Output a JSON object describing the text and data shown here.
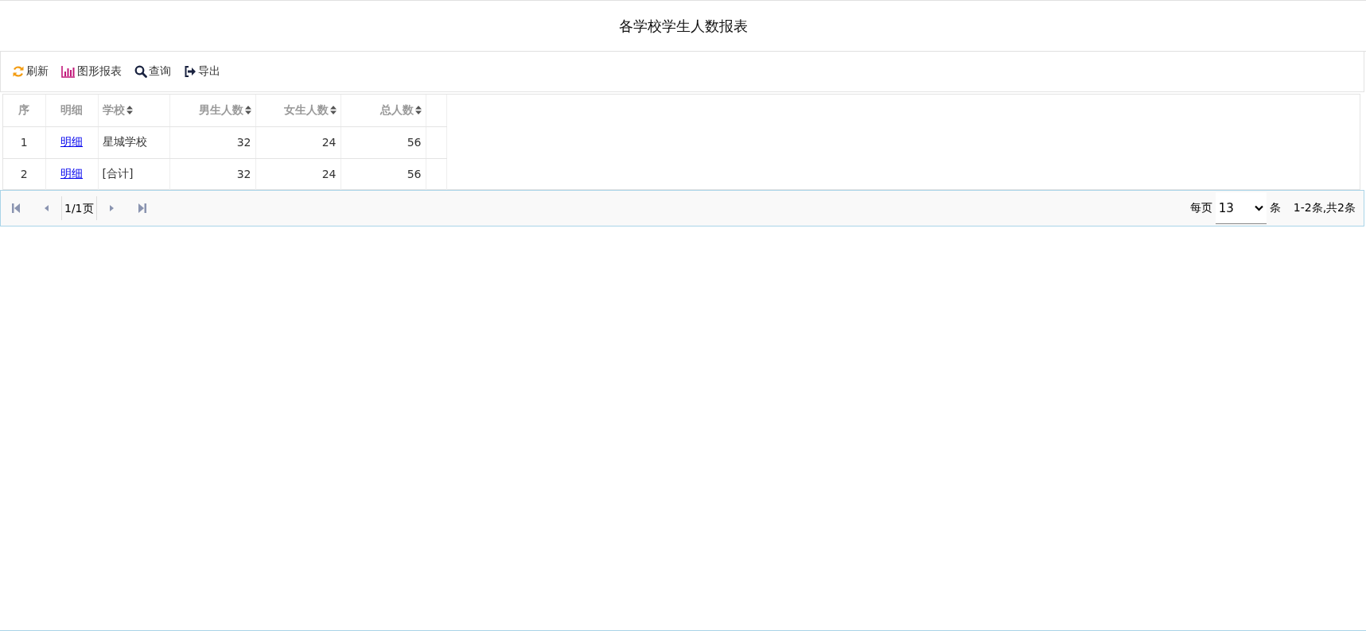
{
  "title": "各学校学生人数报表",
  "toolbar": [
    {
      "kind": "refresh",
      "label": "刷新"
    },
    {
      "kind": "chart",
      "label": "图形报表"
    },
    {
      "kind": "search",
      "label": "查询"
    },
    {
      "kind": "export",
      "label": "导出"
    }
  ],
  "table": {
    "columns": [
      {
        "label": "序",
        "sortable": false
      },
      {
        "label": "明细",
        "sortable": false
      },
      {
        "label": "学校",
        "sortable": true
      },
      {
        "label": "男生人数",
        "sortable": true
      },
      {
        "label": "女生人数",
        "sortable": true
      },
      {
        "label": "总人数",
        "sortable": true
      }
    ],
    "rows": [
      [
        "1",
        "明细",
        "星城学校",
        "32",
        "24",
        "56"
      ],
      [
        "2",
        "明细",
        "[合计]",
        "32",
        "24",
        "56"
      ]
    ]
  },
  "pager": {
    "page": "1/1页",
    "per_page_label": "每页",
    "per_page": "13",
    "unit": "条",
    "summary": "1-2条,共2条"
  }
}
